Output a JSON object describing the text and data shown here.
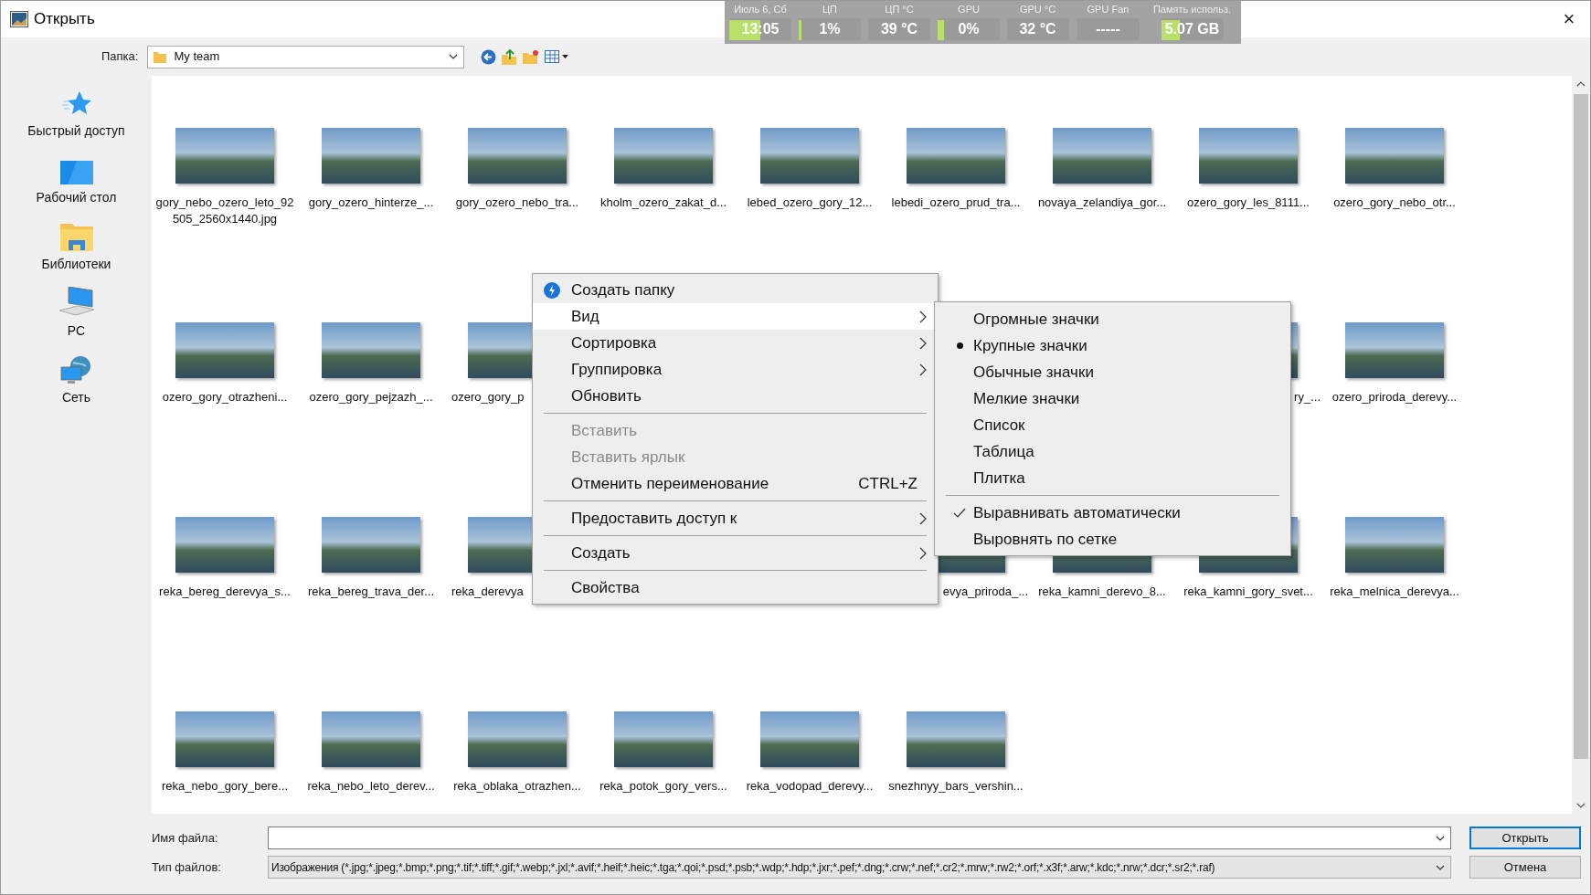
{
  "window": {
    "title": "Открыть",
    "close": "×"
  },
  "monitor": [
    {
      "label": "Июль 6, Сб",
      "value": "13:05",
      "level": 0.5
    },
    {
      "label": "ЦП",
      "value": "1%",
      "level": 0.05
    },
    {
      "label": "ЦП °C",
      "value": "39 °C"
    },
    {
      "label": "GPU",
      "value": "0%",
      "level": 0.1
    },
    {
      "label": "GPU °C",
      "value": "32 °C"
    },
    {
      "label": "GPU Fan",
      "value": "-----"
    },
    {
      "label": "Память использ.",
      "value": "5.07 GB",
      "level": 0.3
    }
  ],
  "toolbar": {
    "folder_label": "Папка:",
    "folder_value": "My team"
  },
  "sidebar": {
    "items": [
      {
        "label": "Быстрый доступ",
        "kind": "star"
      },
      {
        "label": "Рабочий стол",
        "kind": "desktop"
      },
      {
        "label": "Библиотеки",
        "kind": "library"
      },
      {
        "label": "PC",
        "kind": "pc"
      },
      {
        "label": "Сеть",
        "kind": "network"
      }
    ]
  },
  "files": [
    [
      {
        "kind": "file",
        "label": "gory_nebo_ozero_leto_92505_2560x1440.jpg"
      },
      {
        "kind": "file",
        "label": "gory_ozero_hinterze_..."
      },
      {
        "kind": "file",
        "label": "gory_ozero_nebo_tra..."
      },
      {
        "kind": "file",
        "label": "kholm_ozero_zakat_d..."
      },
      {
        "kind": "file",
        "label": "lebed_ozero_gory_12..."
      },
      {
        "kind": "file",
        "label": "lebedi_ozero_prud_tra..."
      },
      {
        "kind": "file",
        "label": "novaya_zelandiya_gor..."
      },
      {
        "kind": "file",
        "label": "ozero_gory_les_8111..."
      },
      {
        "kind": "file",
        "label": "ozero_gory_nebo_otr..."
      }
    ],
    [
      {
        "kind": "file",
        "label": "ozero_gory_otrazheni..."
      },
      {
        "kind": "file",
        "label": "ozero_gory_pejzazh_..."
      },
      {
        "kind": "cut-right",
        "label": "ozero_gory_p"
      },
      {
        "kind": "covered"
      },
      {
        "kind": "covered"
      },
      {
        "kind": "covered"
      },
      {
        "kind": "covered"
      },
      {
        "kind": "cut-left",
        "label": "ry_..."
      },
      {
        "kind": "file",
        "label": "ozero_priroda_derevy..."
      }
    ],
    [
      {
        "kind": "file",
        "label": "reka_bereg_derevya_s..."
      },
      {
        "kind": "file",
        "label": "reka_bereg_trava_der..."
      },
      {
        "kind": "cut-right",
        "label": "reka_derevya"
      },
      {
        "kind": "covered"
      },
      {
        "kind": "covered"
      },
      {
        "kind": "cut-left",
        "label": "evya_priroda_..."
      },
      {
        "kind": "file",
        "label": "reka_kamni_derevo_8..."
      },
      {
        "kind": "file",
        "label": "reka_kamni_gory_svet..."
      },
      {
        "kind": "file",
        "label": "reka_melnica_derevya..."
      }
    ],
    [
      {
        "kind": "file",
        "label": "reka_nebo_gory_bere..."
      },
      {
        "kind": "file",
        "label": "reka_nebo_leto_derev..."
      },
      {
        "kind": "file",
        "label": "reka_oblaka_otrazhen..."
      },
      {
        "kind": "file",
        "label": "reka_potok_gory_vers..."
      },
      {
        "kind": "file",
        "label": "reka_vodopad_derevy..."
      },
      {
        "kind": "file",
        "label": "snezhnyy_bars_vershin..."
      }
    ]
  ],
  "context_menu": [
    {
      "kind": "item",
      "label": "Создать папку",
      "icon": true,
      "selected": false,
      "disabled": false,
      "submenu": false
    },
    {
      "kind": "item",
      "label": "Вид",
      "icon": false,
      "selected": true,
      "disabled": false,
      "submenu": true
    },
    {
      "kind": "item",
      "label": "Сортировка",
      "icon": false,
      "selected": false,
      "disabled": false,
      "submenu": true
    },
    {
      "kind": "item",
      "label": "Группировка",
      "icon": false,
      "selected": false,
      "disabled": false,
      "submenu": true
    },
    {
      "kind": "item",
      "label": "Обновить",
      "icon": false,
      "selected": false,
      "disabled": false,
      "submenu": false
    },
    {
      "kind": "separator"
    },
    {
      "kind": "item",
      "label": "Вставить",
      "icon": false,
      "selected": false,
      "disabled": true,
      "submenu": false
    },
    {
      "kind": "item",
      "label": "Вставить ярлык",
      "icon": false,
      "selected": false,
      "disabled": true,
      "submenu": false
    },
    {
      "kind": "item",
      "label": "Отменить переименование",
      "shortcut": "CTRL+Z",
      "icon": false,
      "selected": false,
      "disabled": false,
      "submenu": false
    },
    {
      "kind": "separator"
    },
    {
      "kind": "item",
      "label": "Предоставить доступ к",
      "icon": false,
      "selected": false,
      "disabled": false,
      "submenu": true
    },
    {
      "kind": "separator"
    },
    {
      "kind": "item",
      "label": "Создать",
      "icon": false,
      "selected": false,
      "disabled": false,
      "submenu": true
    },
    {
      "kind": "separator"
    },
    {
      "kind": "item",
      "label": "Свойства",
      "icon": false,
      "selected": false,
      "disabled": false,
      "submenu": false
    }
  ],
  "view_submenu": [
    {
      "kind": "radio",
      "label": "Огромные значки",
      "checked": false
    },
    {
      "kind": "radio",
      "label": "Крупные значки",
      "checked": true
    },
    {
      "kind": "radio",
      "label": "Обычные значки",
      "checked": false
    },
    {
      "kind": "radio",
      "label": "Мелкие значки",
      "checked": false
    },
    {
      "kind": "radio",
      "label": "Список",
      "checked": false
    },
    {
      "kind": "radio",
      "label": "Таблица",
      "checked": false
    },
    {
      "kind": "radio",
      "label": "Плитка",
      "checked": false
    },
    {
      "kind": "separator"
    },
    {
      "kind": "check",
      "label": "Выравнивать автоматически",
      "checked": true
    },
    {
      "kind": "check",
      "label": "Выровнять по сетке",
      "checked": false
    }
  ],
  "bottom": {
    "filename_label": "Имя файла:",
    "filetype_label": "Тип файлов:",
    "filetype_value": "Изображения (*.jpg;*.jpeg;*.bmp;*.png;*.tif;*.tiff;*.gif;*.webp;*.jxl;*.avif;*.heif;*.heic;*.tga;*.qoi;*.psd;*.psb;*.wdp;*.hdp;*.jxr;*.pef;*.dng;*.crw;*.nef;*.cr2;*.mrw;*.rw2;*.orf;*.x3f;*.arw;*.kdc;*.nrw;*.dcr;*.sr2;*.raf)",
    "open_button": "Открыть",
    "cancel_button": "Отмена"
  }
}
